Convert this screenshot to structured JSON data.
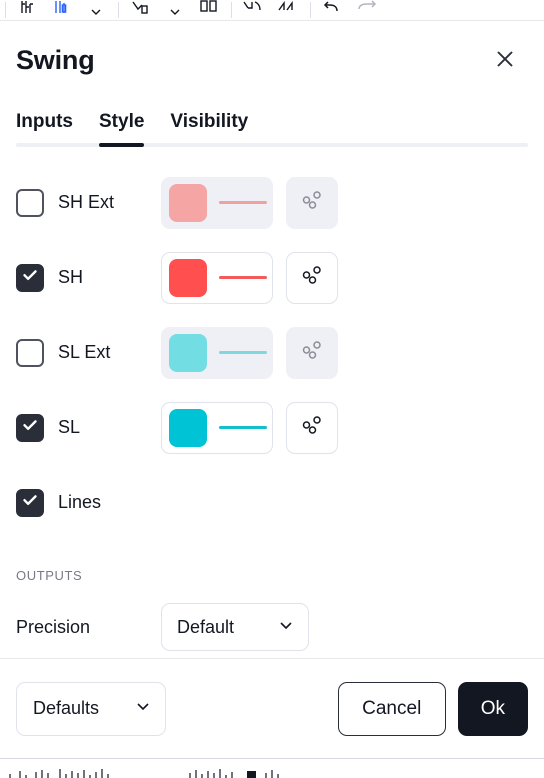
{
  "toolbar": {
    "items": [
      {
        "name": "bar-chart-icon",
        "label": "Bar chart"
      },
      {
        "name": "candlestick-chart-icon",
        "label": "Candles"
      },
      {
        "name": "chevron-down-icon",
        "label": "Chart type menu"
      },
      {
        "name": "indicators-icon",
        "label": "Indicators"
      },
      {
        "name": "chevron-down-icon",
        "label": "Indicators menu"
      },
      {
        "name": "compare-icon",
        "label": "Compare"
      },
      {
        "name": "drawing-tools-icon",
        "label": "Measure"
      },
      {
        "name": "zigzag-icon",
        "label": "Zig zag"
      },
      {
        "name": "undo-icon",
        "label": "Undo"
      },
      {
        "name": "redo-icon",
        "label": "Redo"
      }
    ]
  },
  "dialog": {
    "title": "Swing",
    "close_icon": "close-icon",
    "tabs": [
      {
        "label": "Inputs",
        "active": false
      },
      {
        "label": "Style",
        "active": true
      },
      {
        "label": "Visibility",
        "active": false
      }
    ],
    "style_rows": [
      {
        "label": "SH Ext",
        "checked": false,
        "enabled": false,
        "color": "#F6A5A5",
        "line_color": "#F0A0A0",
        "dots_icon": "circles-icon"
      },
      {
        "label": "SH",
        "checked": true,
        "enabled": true,
        "color": "#FF4F4F",
        "line_color": "#F25B5B",
        "dots_icon": "circles-icon"
      },
      {
        "label": "SL Ext",
        "checked": false,
        "enabled": false,
        "color": "#73DDE4",
        "line_color": "#7ED9DE",
        "dots_icon": "circles-icon"
      },
      {
        "label": "SL",
        "checked": true,
        "enabled": true,
        "color": "#00C4D6",
        "line_color": "#11BFCE",
        "dots_icon": "circles-icon"
      },
      {
        "label": "Lines",
        "checked": true,
        "enabled": true,
        "has_style_control": false,
        "dots_icon": null
      }
    ],
    "outputs": {
      "section_label": "OUTPUTS",
      "precision": {
        "label": "Precision",
        "value": "Default",
        "chevron_icon": "chevron-down-icon"
      }
    },
    "footer": {
      "defaults": {
        "label": "Defaults",
        "chevron_icon": "chevron-down-icon"
      },
      "cancel_label": "Cancel",
      "ok_label": "Ok"
    }
  },
  "colors": {
    "accent_dark": "#131722",
    "border": "#e0e3eb",
    "disabled_bg": "#eef0f5",
    "muted_text": "#787b86"
  }
}
